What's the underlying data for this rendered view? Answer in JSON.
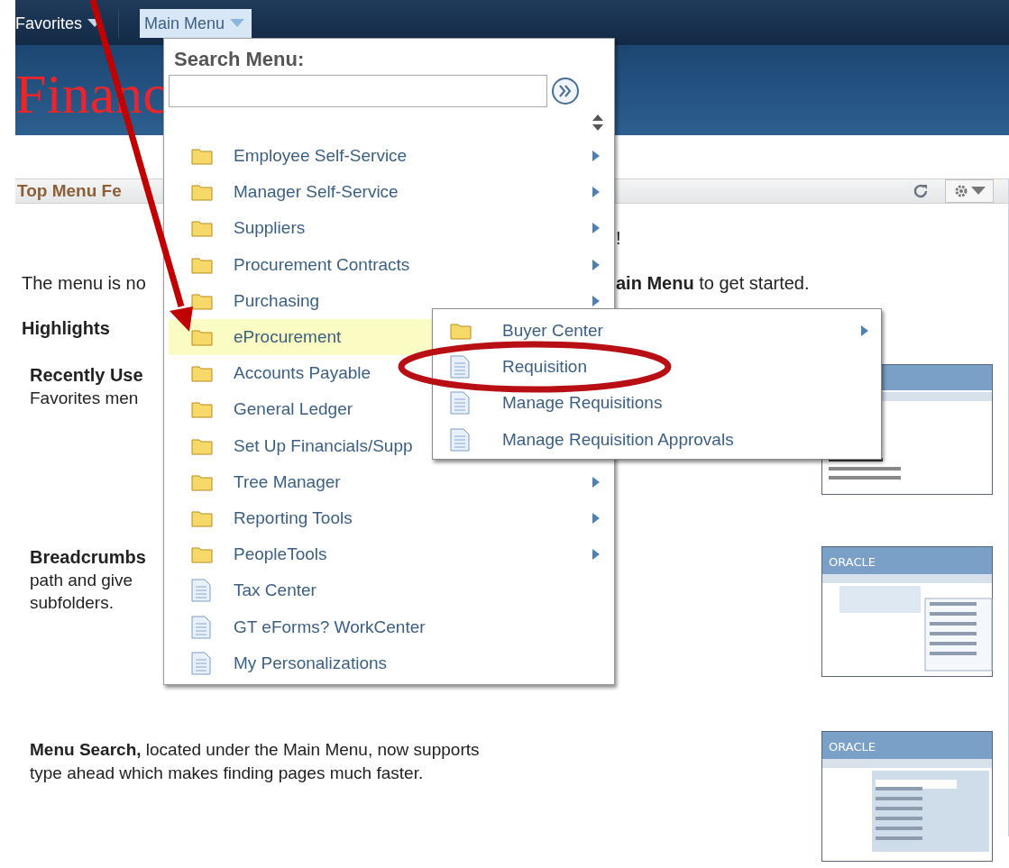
{
  "nav": {
    "items": [
      {
        "label": "Favorites",
        "selected": false
      },
      {
        "label": "Main Menu",
        "selected": true
      }
    ]
  },
  "banner": {
    "title": "Financ"
  },
  "portlet": {
    "title": "Top Menu Fe",
    "welcome_tail": "!",
    "intro_left": "The menu is no",
    "intro_right": "**ain Menu** to get started.",
    "heading": "Highlights",
    "sections": [
      {
        "kind": "titled",
        "title": "Recently Use",
        "lines": [
          "Favorites men"
        ],
        "thumbnail": {
          "kind": "favorites"
        }
      },
      {
        "kind": "titled",
        "title": "Breadcrumbs",
        "lines": [
          "path and give",
          "subfolders."
        ],
        "thumbnail": {
          "kind": "breadcrumbs",
          "logo": "ORACLE"
        }
      },
      {
        "kind": "paragraph",
        "text": "**Menu Search,** located under the Main Menu, now supports type ahead which makes finding pages much faster.",
        "thumbnail": {
          "kind": "search",
          "logo": "ORACLE"
        }
      }
    ]
  },
  "main_menu": {
    "search_label": "Search Menu:",
    "items": [
      {
        "label": "Employee Self-Service",
        "kind": "folder",
        "has_submenu": true,
        "selected": false
      },
      {
        "label": "Manager Self-Service",
        "kind": "folder",
        "has_submenu": true,
        "selected": false
      },
      {
        "label": "Suppliers",
        "kind": "folder",
        "has_submenu": true,
        "selected": false
      },
      {
        "label": "Procurement Contracts",
        "kind": "folder",
        "has_submenu": true,
        "selected": false
      },
      {
        "label": "Purchasing",
        "kind": "folder",
        "has_submenu": true,
        "selected": false
      },
      {
        "label": "eProcurement",
        "kind": "folder",
        "has_submenu": false,
        "selected": true
      },
      {
        "label": "Accounts Payable",
        "kind": "folder",
        "has_submenu": false,
        "selected": false
      },
      {
        "label": "General Ledger",
        "kind": "folder",
        "has_submenu": false,
        "selected": false
      },
      {
        "label": "Set Up Financials/Supp",
        "kind": "folder",
        "has_submenu": false,
        "selected": false
      },
      {
        "label": "Tree Manager",
        "kind": "folder",
        "has_submenu": true,
        "selected": false
      },
      {
        "label": "Reporting Tools",
        "kind": "folder",
        "has_submenu": true,
        "selected": false
      },
      {
        "label": "PeopleTools",
        "kind": "folder",
        "has_submenu": true,
        "selected": false
      },
      {
        "label": "Tax Center",
        "kind": "page",
        "has_submenu": false,
        "selected": false
      },
      {
        "label": "GT eForms? WorkCenter",
        "kind": "page",
        "has_submenu": false,
        "selected": false
      },
      {
        "label": "My Personalizations",
        "kind": "page",
        "has_submenu": false,
        "selected": false
      }
    ]
  },
  "submenu": {
    "items": [
      {
        "label": "Buyer Center",
        "kind": "folder",
        "has_submenu": true,
        "selected": false
      },
      {
        "label": "Requisition",
        "kind": "page",
        "has_submenu": false,
        "selected": false
      },
      {
        "label": "Manage Requisitions",
        "kind": "page",
        "has_submenu": false,
        "selected": false
      },
      {
        "label": "Manage Requisition Approvals",
        "kind": "page",
        "has_submenu": false,
        "selected": false
      }
    ]
  },
  "annotations": [
    {
      "kind": "arrow"
    },
    {
      "kind": "ellipse"
    }
  ]
}
